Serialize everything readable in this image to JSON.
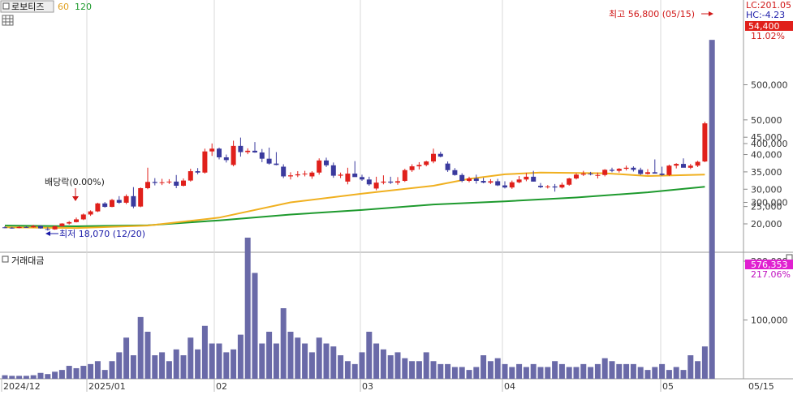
{
  "legend": {
    "symbol": "로보티즈",
    "ma_short": "60",
    "ma_long": "120"
  },
  "status": {
    "lc": "LC:201.05",
    "hc": "HC:-4.23"
  },
  "price_panel": {
    "last_price": "54,400",
    "change_pct": "11.02%",
    "high_annotation": "최고 56,800 (05/15)",
    "low_annotation": "최저 18,070 (12/20)",
    "dividend_annotation": "배당락(0.00%)"
  },
  "volume_panel": {
    "title": "거래대금",
    "last_volume": "576,353",
    "volume_pct": "217.06%"
  },
  "colors": {
    "up": "#e0201b",
    "down": "#3a3a9e",
    "ma60": "#f0b020",
    "ma120": "#1e9a2e",
    "volume": "#6a6aa8",
    "volume_badge": "#e020d0",
    "price_badge": "#e0201b"
  },
  "chart_data": [
    {
      "type": "candlestick",
      "yticks": [
        20000,
        25000,
        30000,
        35000,
        40000,
        45000,
        50000
      ],
      "yticklabels": [
        "20,000",
        "25,000",
        "30,000",
        "35,000",
        "40,000",
        "45,000",
        "50,000"
      ],
      "ylim": [
        17000,
        57500
      ],
      "xticklabels": [
        "2024/12",
        "2025/01",
        "02",
        "03",
        "04",
        "05",
        "05/15"
      ],
      "grid": true,
      "candles": [
        [
          19000,
          19300,
          18700,
          18900
        ],
        [
          18900,
          19100,
          18600,
          18800
        ],
        [
          18800,
          19300,
          18700,
          19100
        ],
        [
          19100,
          19300,
          18900,
          19000
        ],
        [
          19000,
          19700,
          18900,
          19400
        ],
        [
          19400,
          19600,
          18600,
          18700
        ],
        [
          18500,
          19000,
          18070,
          18300
        ],
        [
          18400,
          19500,
          18300,
          19300
        ],
        [
          19300,
          20200,
          19200,
          20100
        ],
        [
          20100,
          20800,
          19800,
          20500
        ],
        [
          20500,
          21800,
          20400,
          21300
        ],
        [
          21300,
          23000,
          21100,
          22700
        ],
        [
          22700,
          23900,
          22300,
          23600
        ],
        [
          23600,
          26100,
          23400,
          25900
        ],
        [
          25900,
          26300,
          24700,
          24900
        ],
        [
          24900,
          27200,
          24800,
          26900
        ],
        [
          26900,
          28000,
          25800,
          26100
        ],
        [
          26100,
          28500,
          25700,
          28000
        ],
        [
          28000,
          30600,
          24500,
          25000
        ],
        [
          25000,
          30500,
          24800,
          30300
        ],
        [
          30300,
          36200,
          30000,
          32100
        ],
        [
          32100,
          33200,
          31100,
          31800
        ],
        [
          31800,
          33000,
          31200,
          32000
        ],
        [
          32000,
          32900,
          31500,
          32200
        ],
        [
          32200,
          34100,
          30300,
          31000
        ],
        [
          31000,
          33100,
          30800,
          32500
        ],
        [
          32500,
          35900,
          32200,
          35200
        ],
        [
          35200,
          36100,
          34300,
          34800
        ],
        [
          34800,
          41700,
          34500,
          40900
        ],
        [
          40900,
          43200,
          39600,
          41700
        ],
        [
          41700,
          42000,
          38600,
          39200
        ],
        [
          39200,
          40000,
          37700,
          38400
        ],
        [
          37000,
          44000,
          36600,
          42500
        ],
        [
          42500,
          44900,
          39400,
          40700
        ],
        [
          40700,
          41800,
          40100,
          41100
        ],
        [
          41100,
          43600,
          40500,
          40600
        ],
        [
          40600,
          41600,
          37800,
          38800
        ],
        [
          38800,
          42000,
          37100,
          37400
        ],
        [
          37400,
          40700,
          36900,
          37000
        ],
        [
          36500,
          37200,
          33200,
          33700
        ],
        [
          33700,
          34900,
          32800,
          34000
        ],
        [
          34000,
          35200,
          33500,
          34300
        ],
        [
          34300,
          35300,
          33700,
          34500
        ],
        [
          33700,
          35200,
          33000,
          34800
        ],
        [
          34800,
          38900,
          34200,
          38300
        ],
        [
          38300,
          39100,
          36400,
          36900
        ],
        [
          36900,
          37700,
          33300,
          33900
        ],
        [
          33900,
          34800,
          33200,
          34200
        ],
        [
          32200,
          36200,
          31400,
          34500
        ],
        [
          34500,
          38100,
          34000,
          33500
        ],
        [
          33500,
          34200,
          32400,
          32800
        ],
        [
          32800,
          33600,
          31000,
          31400
        ],
        [
          30200,
          33600,
          29700,
          31900
        ],
        [
          31900,
          34000,
          31400,
          32200
        ],
        [
          32200,
          33600,
          31500,
          31900
        ],
        [
          31900,
          33500,
          31300,
          32300
        ],
        [
          32400,
          35900,
          32100,
          35500
        ],
        [
          35500,
          37200,
          35000,
          36600
        ],
        [
          36600,
          37800,
          35700,
          37000
        ],
        [
          37000,
          38200,
          36600,
          38000
        ],
        [
          38000,
          41700,
          37500,
          40200
        ],
        [
          40200,
          40800,
          39200,
          39400
        ],
        [
          37400,
          38000,
          35000,
          35500
        ],
        [
          35500,
          36100,
          33900,
          34100
        ],
        [
          34100,
          34600,
          32000,
          32400
        ],
        [
          32400,
          33600,
          32000,
          33100
        ],
        [
          33100,
          34200,
          31600,
          32400
        ],
        [
          32400,
          33300,
          31700,
          31900
        ],
        [
          31900,
          32900,
          31500,
          32300
        ],
        [
          32300,
          33000,
          30900,
          31100
        ],
        [
          31100,
          32300,
          30200,
          30500
        ],
        [
          30500,
          32500,
          30100,
          32000
        ],
        [
          32000,
          33800,
          31700,
          32800
        ],
        [
          32800,
          34700,
          32300,
          33600
        ],
        [
          33600,
          35300,
          32200,
          32200
        ],
        [
          31000,
          31800,
          30300,
          30600
        ],
        [
          30600,
          31200,
          30200,
          30800
        ],
        [
          30800,
          31500,
          29300,
          30500
        ],
        [
          30500,
          31900,
          30200,
          31300
        ],
        [
          31300,
          33300,
          31000,
          33100
        ],
        [
          33100,
          34600,
          32800,
          34200
        ],
        [
          34200,
          35300,
          33800,
          34500
        ],
        [
          34500,
          35000,
          34000,
          34300
        ],
        [
          34000,
          34800,
          33100,
          34100
        ],
        [
          34100,
          35800,
          33700,
          35600
        ],
        [
          35600,
          36200,
          34900,
          35300
        ],
        [
          35300,
          36100,
          34800,
          35900
        ],
        [
          35900,
          36800,
          35400,
          36200
        ],
        [
          36200,
          36600,
          35100,
          35600
        ],
        [
          35600,
          36200,
          34100,
          34400
        ],
        [
          34400,
          35800,
          34200,
          34900
        ],
        [
          34900,
          38600,
          34600,
          34500
        ],
        [
          34500,
          36500,
          33900,
          34100
        ],
        [
          34100,
          37100,
          33800,
          36800
        ],
        [
          36800,
          37500,
          36000,
          37300
        ],
        [
          37300,
          38900,
          37000,
          36200
        ],
        [
          36200,
          37300,
          35800,
          36800
        ],
        [
          36800,
          38200,
          36400,
          37900
        ],
        [
          38000,
          49500,
          37800,
          49000
        ],
        [
          49000,
          56800,
          47900,
          54400
        ]
      ],
      "ma60_anchors": [
        [
          0,
          19000
        ],
        [
          10,
          18800
        ],
        [
          20,
          19500
        ],
        [
          30,
          21800
        ],
        [
          40,
          26200
        ],
        [
          50,
          28700
        ],
        [
          60,
          31000
        ],
        [
          65,
          33000
        ],
        [
          70,
          34300
        ],
        [
          75,
          34800
        ],
        [
          84,
          34600
        ],
        [
          90,
          33800
        ],
        [
          98,
          34200
        ]
      ],
      "ma120_anchors": [
        [
          0,
          19500
        ],
        [
          10,
          19300
        ],
        [
          20,
          19600
        ],
        [
          30,
          21000
        ],
        [
          40,
          22700
        ],
        [
          50,
          24000
        ],
        [
          60,
          25600
        ],
        [
          70,
          26500
        ],
        [
          80,
          27600
        ],
        [
          90,
          29100
        ],
        [
          98,
          30700
        ]
      ]
    },
    {
      "type": "bar",
      "title": "거래대금",
      "yticks": [
        100000,
        200000,
        300000,
        400000,
        500000
      ],
      "yticklabels": [
        "100,000",
        "200,000",
        "300,000",
        "400,000",
        "500,000"
      ],
      "ylim": [
        0,
        595000
      ],
      "values": [
        6000,
        5000,
        5000,
        5000,
        6000,
        10000,
        8000,
        12000,
        15000,
        22000,
        18000,
        22000,
        25000,
        30000,
        15000,
        30000,
        45000,
        70000,
        40000,
        105000,
        80000,
        40000,
        45000,
        30000,
        50000,
        40000,
        70000,
        50000,
        90000,
        60000,
        60000,
        45000,
        50000,
        75000,
        240000,
        180000,
        60000,
        80000,
        60000,
        120000,
        80000,
        70000,
        60000,
        45000,
        70000,
        60000,
        55000,
        40000,
        30000,
        25000,
        45000,
        80000,
        60000,
        50000,
        40000,
        45000,
        35000,
        30000,
        30000,
        45000,
        30000,
        25000,
        25000,
        20000,
        20000,
        15000,
        20000,
        40000,
        30000,
        35000,
        25000,
        20000,
        25000,
        20000,
        25000,
        20000,
        20000,
        30000,
        25000,
        20000,
        20000,
        25000,
        20000,
        25000,
        35000,
        30000,
        25000,
        25000,
        25000,
        20000,
        15000,
        20000,
        25000,
        15000,
        20000,
        15000,
        40000,
        30000,
        55000,
        576353
      ]
    }
  ]
}
